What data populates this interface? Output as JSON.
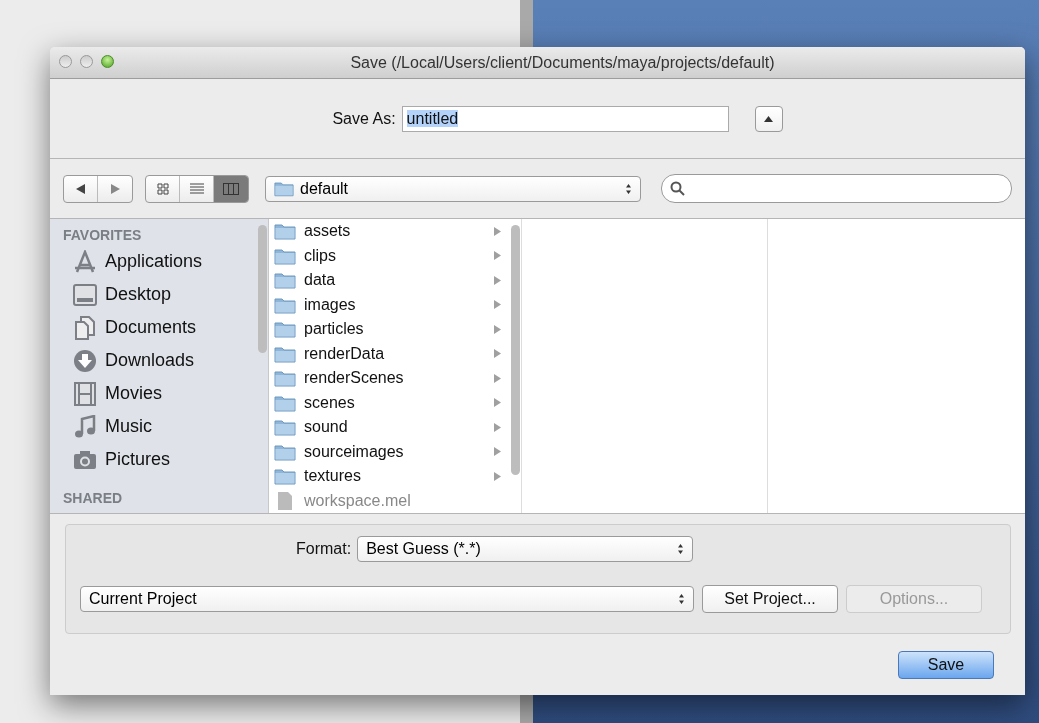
{
  "window": {
    "title": "Save (/Local/Users/client/Documents/maya/projects/default)"
  },
  "save_as": {
    "label": "Save As:",
    "value": "untitled"
  },
  "views": [
    {
      "kind": "icons",
      "selected": false
    },
    {
      "kind": "list",
      "selected": false
    },
    {
      "kind": "columns",
      "selected": true
    }
  ],
  "location": {
    "value": "default"
  },
  "sidebar": {
    "sections": [
      {
        "title": "FAVORITES",
        "items": [
          {
            "label": "Applications",
            "kind": "apps"
          },
          {
            "label": "Desktop",
            "kind": "desktop"
          },
          {
            "label": "Documents",
            "kind": "documents"
          },
          {
            "label": "Downloads",
            "kind": "downloads"
          },
          {
            "label": "Movies",
            "kind": "movies"
          },
          {
            "label": "Music",
            "kind": "music"
          },
          {
            "label": "Pictures",
            "kind": "pictures"
          }
        ]
      },
      {
        "title": "SHARED"
      }
    ]
  },
  "files": [
    {
      "name": "assets",
      "kind": "folder",
      "disabled": false
    },
    {
      "name": "clips",
      "kind": "folder",
      "disabled": false
    },
    {
      "name": "data",
      "kind": "folder",
      "disabled": false
    },
    {
      "name": "images",
      "kind": "folder",
      "disabled": false
    },
    {
      "name": "particles",
      "kind": "folder",
      "disabled": false
    },
    {
      "name": "renderData",
      "kind": "folder",
      "disabled": false
    },
    {
      "name": "renderScenes",
      "kind": "folder",
      "disabled": false
    },
    {
      "name": "scenes",
      "kind": "folder",
      "disabled": false
    },
    {
      "name": "sound",
      "kind": "folder",
      "disabled": false
    },
    {
      "name": "sourceimages",
      "kind": "folder",
      "disabled": false
    },
    {
      "name": "textures",
      "kind": "folder",
      "disabled": false
    },
    {
      "name": "workspace.mel",
      "kind": "file",
      "disabled": true
    }
  ],
  "format": {
    "label": "Format:",
    "value": "Best Guess (*.*)"
  },
  "project": {
    "value": "Current Project"
  },
  "buttons": [
    {
      "label": "Set Project...",
      "disabled": false
    },
    {
      "label": "Options...",
      "disabled": true
    }
  ],
  "save_button": {
    "label": "Save"
  }
}
